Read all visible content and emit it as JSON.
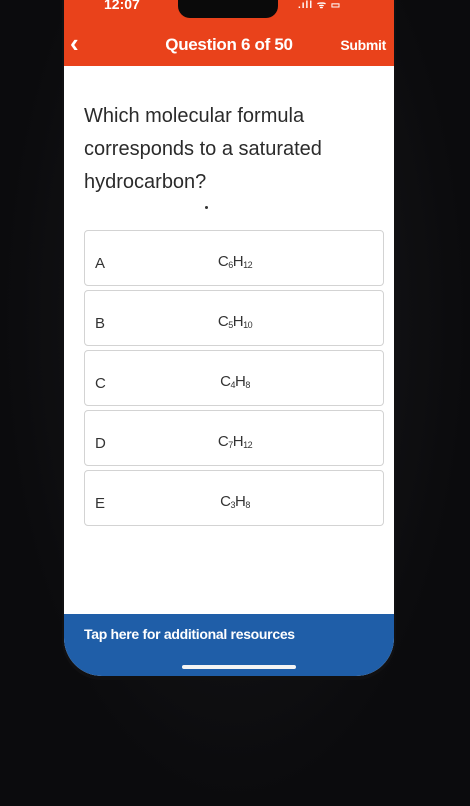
{
  "status_bar": {
    "time": "12:07",
    "icons": ".ıll ᯤ ▭"
  },
  "header": {
    "back_icon": "chevron-left-icon",
    "title": "Question 6 of 50",
    "submit_label": "Submit"
  },
  "question": {
    "text": "Which molecular formula corresponds to a saturated hydrocarbon?"
  },
  "options": [
    {
      "letter": "A",
      "formula": [
        {
          "t": "C"
        },
        {
          "s": "6"
        },
        {
          "t": "H"
        },
        {
          "s": "12"
        }
      ]
    },
    {
      "letter": "B",
      "formula": [
        {
          "t": "C"
        },
        {
          "s": "5"
        },
        {
          "t": "H"
        },
        {
          "s": "10"
        }
      ]
    },
    {
      "letter": "C",
      "formula": [
        {
          "t": "C"
        },
        {
          "s": "4"
        },
        {
          "t": "H"
        },
        {
          "s": "8"
        }
      ]
    },
    {
      "letter": "D",
      "formula": [
        {
          "t": "C"
        },
        {
          "s": "7"
        },
        {
          "t": "H"
        },
        {
          "s": "12"
        }
      ]
    },
    {
      "letter": "E",
      "formula": [
        {
          "t": "C"
        },
        {
          "s": "3"
        },
        {
          "t": "H"
        },
        {
          "s": "8"
        }
      ]
    }
  ],
  "resources": {
    "label": "Tap here for additional resources"
  },
  "colors": {
    "header": "#e9421b",
    "resources_bar": "#1f5ea8"
  }
}
